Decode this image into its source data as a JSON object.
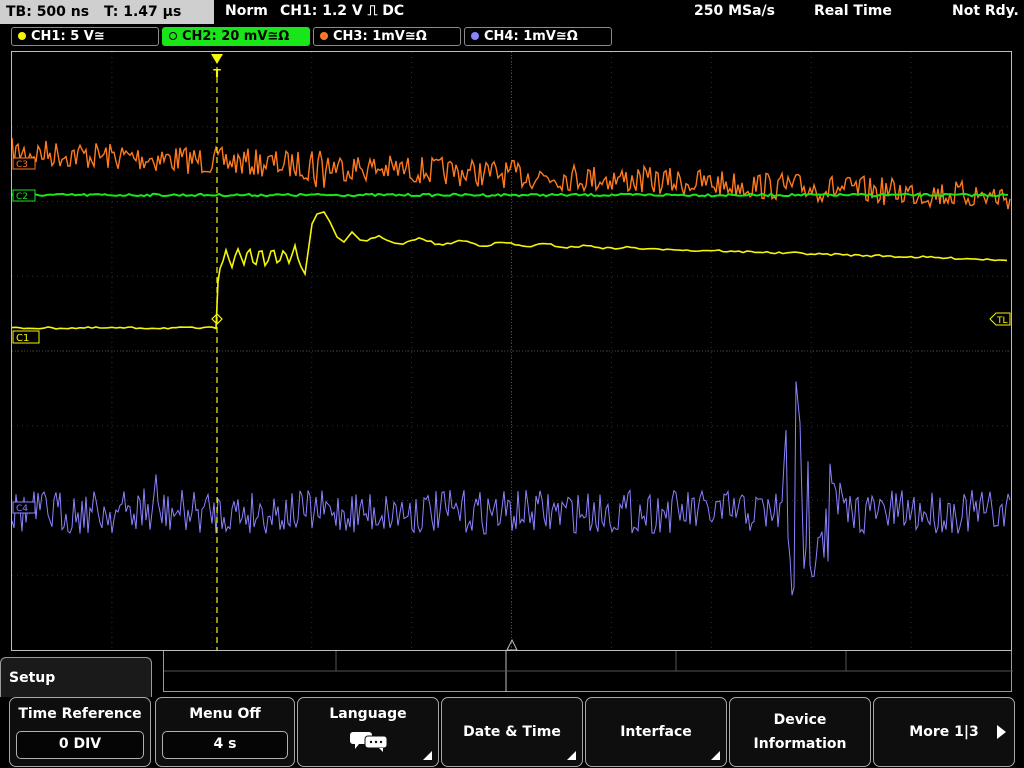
{
  "status": {
    "timebase": "TB: 500 ns",
    "trigger_time": "T: 1.47 µs",
    "mode": "Norm",
    "trigger": "CH1: 1.2 V ⎍ DC",
    "sample_rate": "250 MSa/s",
    "acq_mode": "Real Time",
    "state": "Not Rdy."
  },
  "channels": [
    {
      "label": "CH1: 5 V≅",
      "color": "#f5f50a"
    },
    {
      "label": "CH2: 20 mV≅Ω",
      "color": "#19e619"
    },
    {
      "label": "CH3: 1mV≅Ω",
      "color": "#ff7a1e"
    },
    {
      "label": "CH4: 1mV≅Ω",
      "color": "#8b82ff"
    }
  ],
  "markers": {
    "c1": "C1",
    "c2": "C2",
    "c3": "C3",
    "c4": "C4",
    "tl": "TL",
    "trigger": "T"
  },
  "menu": {
    "title": "Setup",
    "time_reference": {
      "title": "Time Reference",
      "value": "0 DIV"
    },
    "menu_off": {
      "title": "Menu Off",
      "value": "4 s"
    },
    "language": {
      "title": "Language"
    },
    "date_time": {
      "title": "Date & Time"
    },
    "interface": {
      "title": "Interface"
    },
    "device_info": {
      "title": "Device Information"
    },
    "more": {
      "title": "More 1|3"
    }
  },
  "icons": [
    "speech-bubbles-icon",
    "menu-corner-icon",
    "next-page-icon"
  ]
}
